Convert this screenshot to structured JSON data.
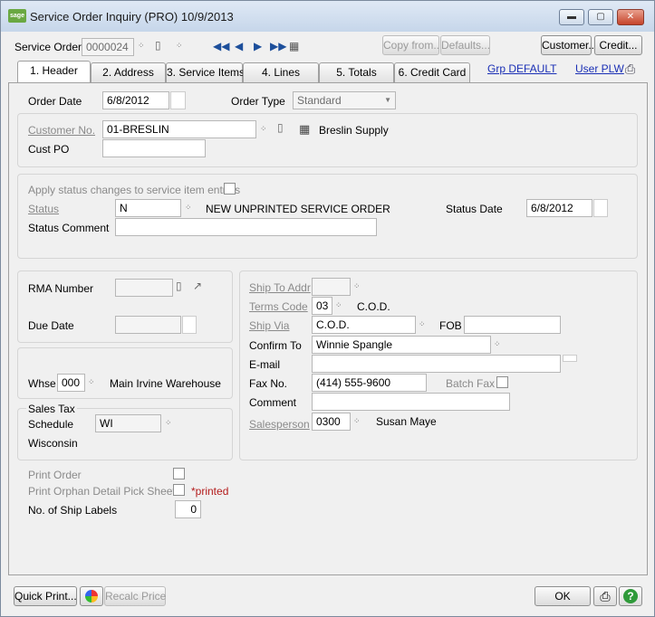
{
  "window": {
    "title": "Service Order Inquiry (PRO) 10/9/2013",
    "logo_text": "sage",
    "minimize": "▬",
    "maximize": "▢",
    "close": "✕"
  },
  "toolbar": {
    "service_order_label": "Service Order",
    "service_order_value": "0000024",
    "copy_from": "Copy from...",
    "defaults": "Defaults...",
    "customer": "Customer...",
    "credit": "Credit..."
  },
  "tabs": [
    {
      "label": "1. Header",
      "active": true
    },
    {
      "label": "2. Address"
    },
    {
      "label": "3. Service Items"
    },
    {
      "label": "4. Lines"
    },
    {
      "label": "5. Totals"
    },
    {
      "label": "6. Credit Card"
    }
  ],
  "links": {
    "grp": "Grp DEFAULT",
    "user": "User PLW"
  },
  "header": {
    "order_date_label": "Order Date",
    "order_date": "6/8/2012",
    "order_type_label": "Order Type",
    "order_type": "Standard",
    "customer_no_label": "Customer No.",
    "customer_no": "01-BRESLIN",
    "customer_name": "Breslin Supply",
    "cust_po_label": "Cust PO",
    "cust_po": "",
    "apply_status_label": "Apply status changes to service item entries",
    "status_label": "Status",
    "status": "N",
    "status_desc": "NEW UNPRINTED SERVICE ORDER",
    "status_date_label": "Status Date",
    "status_date": "6/8/2012",
    "status_comment_label": "Status Comment",
    "status_comment": "",
    "rma_number_label": "RMA Number",
    "rma_number": "",
    "due_date_label": "Due Date",
    "due_date": "",
    "whse_label": "Whse",
    "whse": "000",
    "whse_desc": "Main  Irvine Warehouse",
    "sales_tax_label": "Sales Tax",
    "schedule_label": "Schedule",
    "schedule": "WI",
    "schedule_desc": "Wisconsin",
    "ship_to_addr_label": "Ship To Addr",
    "ship_to_addr": "",
    "terms_code_label": "Terms Code",
    "terms_code": "03",
    "terms_desc": "C.O.D.",
    "ship_via_label": "Ship Via",
    "ship_via": "C.O.D.",
    "fob_label": "FOB",
    "fob": "",
    "confirm_to_label": "Confirm To",
    "confirm_to": "Winnie Spangle",
    "email_label": "E-mail",
    "email": "",
    "fax_no_label": "Fax No.",
    "fax_no": "(414) 555-9600",
    "batch_fax_label": "Batch Fax",
    "comment_label": "Comment",
    "comment": "",
    "salesperson_label": "Salesperson",
    "salesperson": "0300",
    "salesperson_name": "Susan Maye",
    "print_order_label": "Print Order",
    "print_orphan_label": "Print Orphan Detail Pick Sheets",
    "printed_note": "*printed",
    "ship_labels_label": "No. of Ship Labels",
    "ship_labels": "0"
  },
  "footer": {
    "quick_print": "Quick Print...",
    "recalc_price": "Recalc Price",
    "ok": "OK",
    "help": "?"
  }
}
